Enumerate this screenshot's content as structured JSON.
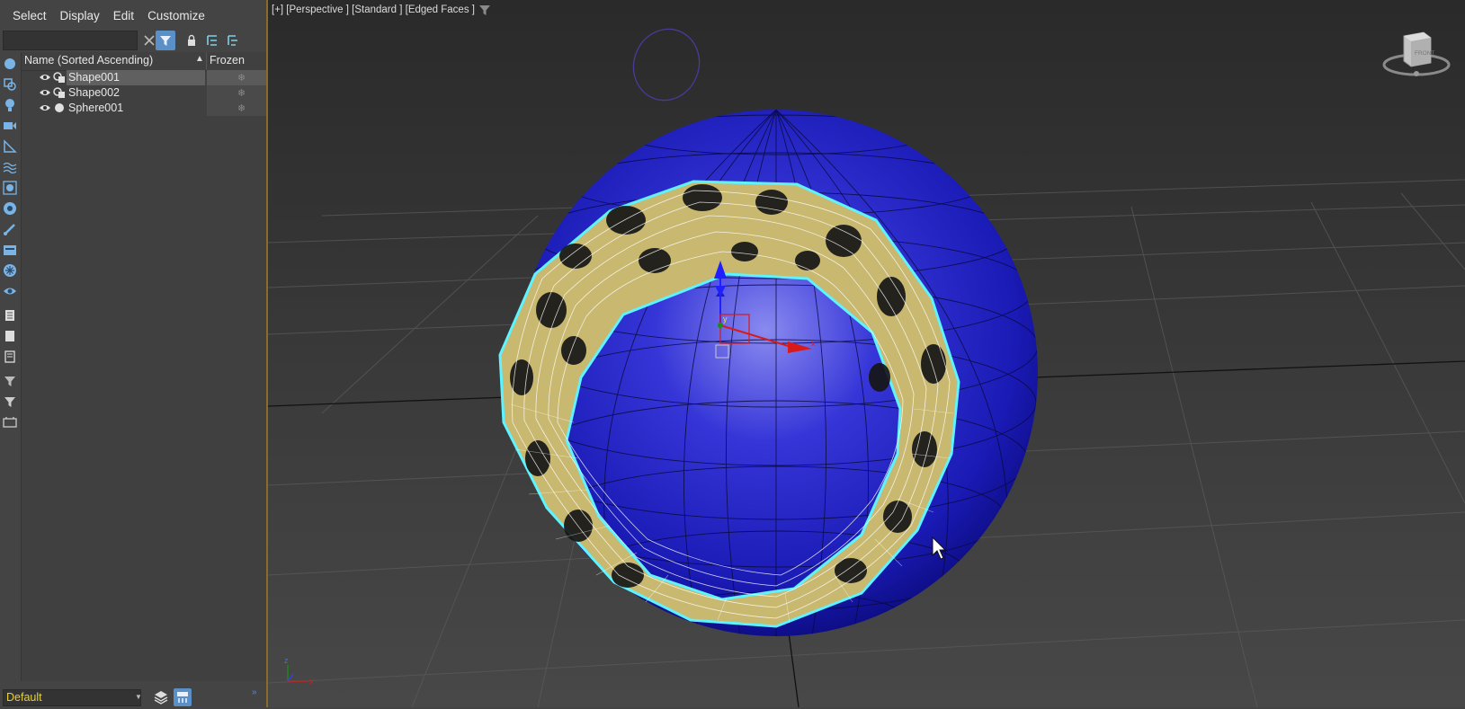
{
  "menu": [
    "Select",
    "Display",
    "Edit",
    "Customize"
  ],
  "explorer": {
    "search_value": "",
    "columns": {
      "name": "Name (Sorted Ascending)",
      "frozen": "Frozen"
    },
    "rows": [
      {
        "name": "Shape001",
        "type_icon": "shape-icon",
        "selected": true
      },
      {
        "name": "Shape002",
        "type_icon": "shape-icon",
        "selected": false
      },
      {
        "name": "Sphere001",
        "type_icon": "geometry-icon",
        "selected": false
      }
    ],
    "layer": "Default"
  },
  "viewport": {
    "label": "[+] [Perspective ] [Standard ] [Edged Faces ]",
    "viewcube_face": "FRONT",
    "gizmo_x": "x",
    "gizmo_y": "y",
    "tripod_x": "x",
    "tripod_z": "z"
  },
  "colors": {
    "sphere": "#1a1ab5",
    "selection_outline": "#5ff2ff",
    "ring_face": "#c8b870",
    "layer_text": "#e8d23a",
    "active_tool": "#5b8fc7"
  }
}
